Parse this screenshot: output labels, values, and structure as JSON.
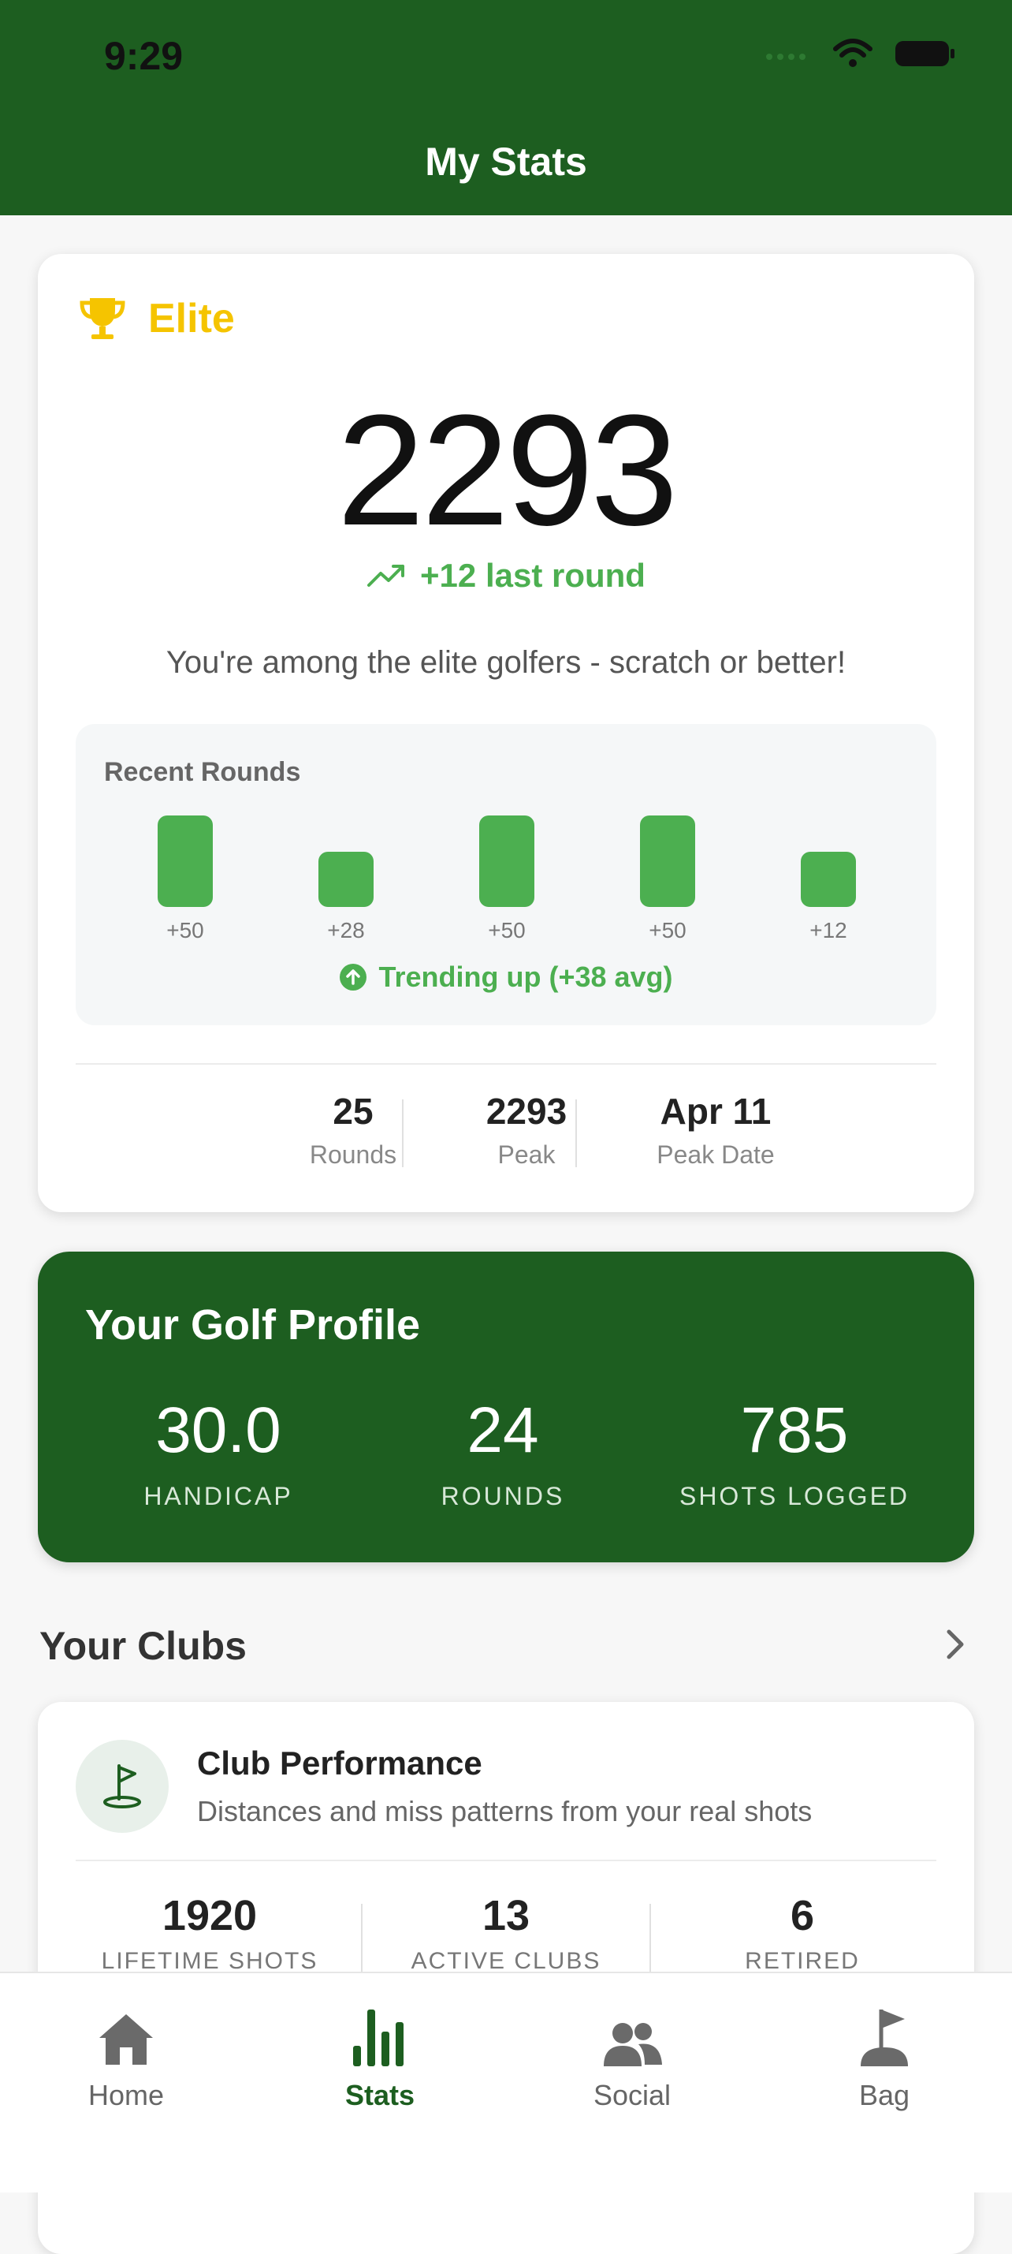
{
  "status_bar": {
    "time": "9:29"
  },
  "header": {
    "title": "My Stats"
  },
  "rating": {
    "tier": "Elite",
    "value": "2293",
    "delta": "+12 last round",
    "description": "You're among the elite golfers - scratch or better!",
    "recent_rounds": {
      "title": "Recent Rounds",
      "rounds": [
        {
          "label": "+50",
          "value": 50
        },
        {
          "label": "+28",
          "value": 28
        },
        {
          "label": "+50",
          "value": 50
        },
        {
          "label": "+50",
          "value": 50
        },
        {
          "label": "+12",
          "value": 12
        }
      ],
      "trend": "Trending up (+38 avg)"
    },
    "stats": [
      {
        "value": "25",
        "label": "Rounds"
      },
      {
        "value": "2293",
        "label": "Peak"
      },
      {
        "value": "Apr 11",
        "label": "Peak Date"
      }
    ]
  },
  "profile": {
    "title": "Your Golf Profile",
    "stats": [
      {
        "value": "30.0",
        "label": "HANDICAP"
      },
      {
        "value": "24",
        "label": "ROUNDS"
      },
      {
        "value": "785",
        "label": "SHOTS LOGGED"
      }
    ]
  },
  "clubs": {
    "section_title": "Your Clubs",
    "card_title": "Club Performance",
    "card_subtitle": "Distances and miss patterns from your real shots",
    "stats": [
      {
        "value": "1920",
        "label": "LIFETIME SHOTS"
      },
      {
        "value": "13",
        "label": "ACTIVE CLUBS"
      },
      {
        "value": "6",
        "label": "RETIRED"
      }
    ]
  },
  "tabs": [
    {
      "label": "Home",
      "icon": "home-icon",
      "active": false
    },
    {
      "label": "Stats",
      "icon": "stats-icon",
      "active": true
    },
    {
      "label": "Social",
      "icon": "social-icon",
      "active": false
    },
    {
      "label": "Bag",
      "icon": "bag-icon",
      "active": false
    }
  ],
  "colors": {
    "brand": "#1d5e20",
    "accent": "#4caf50",
    "gold": "#f5c400"
  }
}
